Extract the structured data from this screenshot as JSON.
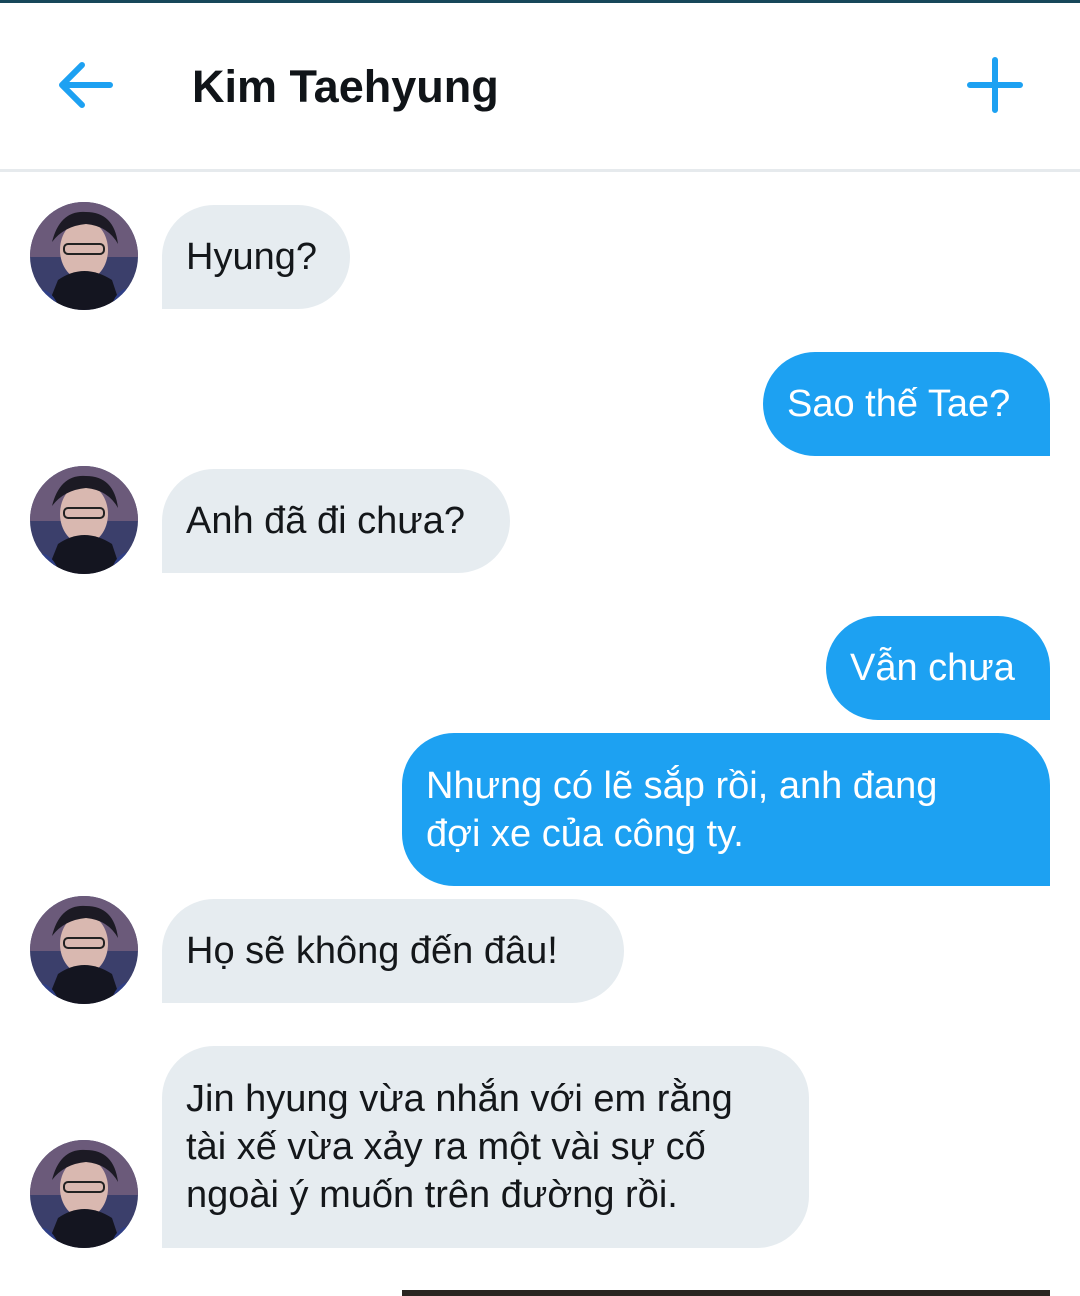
{
  "header": {
    "title": "Kim Taehyung",
    "back_icon": "arrow-left-icon",
    "add_icon": "plus-icon",
    "accent_color": "#1da1f2"
  },
  "colors": {
    "outgoing_bubble": "#1da1f2",
    "incoming_bubble": "#e6ecf0",
    "incoming_text": "#14171a",
    "outgoing_text": "#ffffff"
  },
  "messages": [
    {
      "sender": "them",
      "text": "Hyung?"
    },
    {
      "sender": "me",
      "text": "Sao thế Tae?"
    },
    {
      "sender": "them",
      "text": "Anh đã đi chưa?"
    },
    {
      "sender": "me",
      "text": "Vẫn chưa"
    },
    {
      "sender": "me",
      "text": "Nhưng có lẽ sắp rồi, anh đang\nđợi xe của công ty."
    },
    {
      "sender": "them",
      "text": "Họ sẽ không đến đâu!"
    },
    {
      "sender": "them",
      "text": "Jin hyung vừa nhắn với em rằng\ntài xế vừa xảy ra một vài sự cố\nngoài ý muốn trên đường rồi."
    }
  ]
}
